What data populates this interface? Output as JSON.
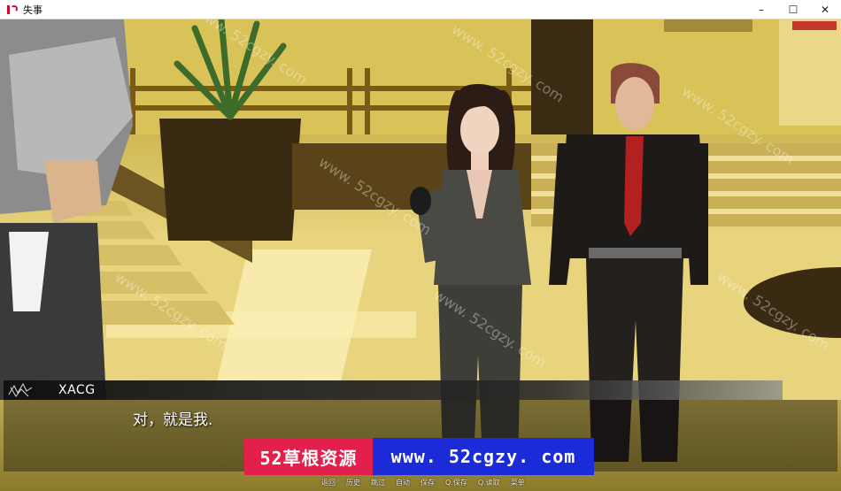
{
  "window": {
    "title": "失事",
    "minimize": "–",
    "maximize": "☐",
    "close": "✕"
  },
  "dialogue": {
    "speaker": "XACG",
    "text": "对，就是我."
  },
  "banner": {
    "left_text": "52草根资源",
    "right_text": "www. 52cgzy. com"
  },
  "quick_menu": [
    "返回",
    "历史",
    "跳过",
    "自动",
    "保存",
    "Q.保存",
    "Q.读取",
    "菜单"
  ],
  "watermark": "www. 52cgzy. com",
  "colors": {
    "banner_left": "#e3204b",
    "banner_right": "#1b2bd8"
  }
}
